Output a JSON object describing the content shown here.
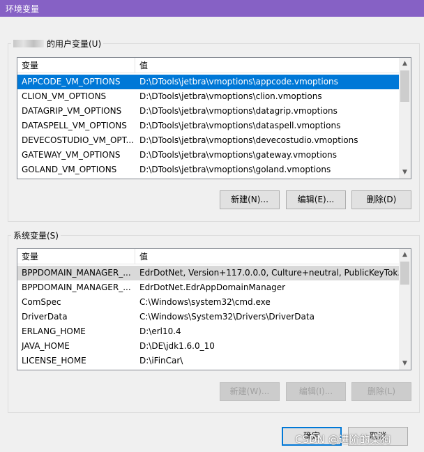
{
  "window": {
    "title": "环境变量"
  },
  "user_vars": {
    "group_label": "的用户变量(U)",
    "columns": [
      "变量",
      "值"
    ],
    "rows": [
      {
        "name": "APPCODE_VM_OPTIONS",
        "value": "D:\\DTools\\jetbra\\vmoptions\\appcode.vmoptions"
      },
      {
        "name": "CLION_VM_OPTIONS",
        "value": "D:\\DTools\\jetbra\\vmoptions\\clion.vmoptions"
      },
      {
        "name": "DATAGRIP_VM_OPTIONS",
        "value": "D:\\DTools\\jetbra\\vmoptions\\datagrip.vmoptions"
      },
      {
        "name": "DATASPELL_VM_OPTIONS",
        "value": "D:\\DTools\\jetbra\\vmoptions\\dataspell.vmoptions"
      },
      {
        "name": "DEVECOSTUDIO_VM_OPT...",
        "value": "D:\\DTools\\jetbra\\vmoptions\\devecostudio.vmoptions"
      },
      {
        "name": "GATEWAY_VM_OPTIONS",
        "value": "D:\\DTools\\jetbra\\vmoptions\\gateway.vmoptions"
      },
      {
        "name": "GOLAND_VM_OPTIONS",
        "value": "D:\\DTools\\jetbra\\vmoptions\\goland.vmoptions"
      }
    ],
    "buttons": {
      "new": "新建(N)...",
      "edit": "编辑(E)...",
      "delete": "删除(D)"
    }
  },
  "system_vars": {
    "group_label": "系统变量(S)",
    "columns": [
      "变量",
      "值"
    ],
    "rows": [
      {
        "name": "BPPDOMAIN_MANAGER_...",
        "value": "EdrDotNet, Version+117.0.0.0, Culture+neutral, PublicKeyTok..."
      },
      {
        "name": "BPPDOMAIN_MANAGER_...",
        "value": "EdrDotNet.EdrAppDomainManager"
      },
      {
        "name": "ComSpec",
        "value": "C:\\Windows\\system32\\cmd.exe"
      },
      {
        "name": "DriverData",
        "value": "C:\\Windows\\System32\\Drivers\\DriverData"
      },
      {
        "name": "ERLANG_HOME",
        "value": "D:\\erl10.4"
      },
      {
        "name": "JAVA_HOME",
        "value": "D:\\DE\\jdk1.6.0_10"
      },
      {
        "name": "LICENSE_HOME",
        "value": "D:\\iFinCar\\"
      }
    ],
    "buttons": {
      "new": "新建(W)...",
      "edit": "编辑(I)...",
      "delete": "删除(L)"
    }
  },
  "footer": {
    "ok": "确定",
    "cancel": "取消"
  },
  "watermark": "CSDN @进阶的菜狗",
  "colors": {
    "titlebar": "#8661c5",
    "selection": "#0078d7"
  }
}
